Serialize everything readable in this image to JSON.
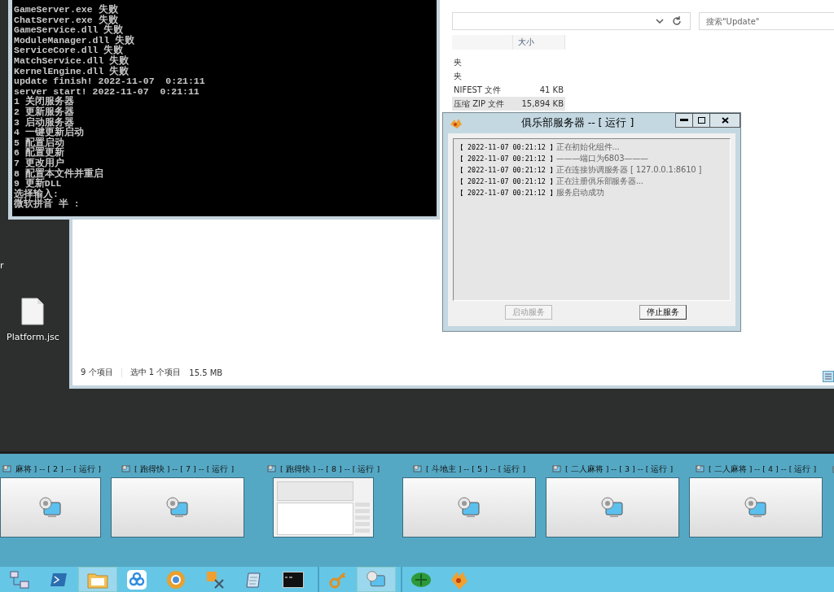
{
  "desktop": {
    "label_fragment": "r",
    "icons": [
      {
        "label": "Platform.jsc"
      }
    ]
  },
  "explorer": {
    "search": {
      "placeholder": "搜索\"Update\""
    },
    "columns": [
      "大小"
    ],
    "rows": [
      {
        "type": "夹",
        "size": "",
        "selected": false
      },
      {
        "type": "夹",
        "size": "",
        "selected": false
      },
      {
        "type": "NIFEST 文件",
        "size": "41 KB",
        "selected": false
      },
      {
        "type": "压缩 ZIP 文件",
        "size": "15,894 KB",
        "selected": true
      }
    ],
    "status": {
      "count": "9 个项目",
      "selection": "选中 1 个项目",
      "size": "15.5 MB"
    }
  },
  "console": {
    "lines": [
      "GameServer.exe 失败",
      "ChatServer.exe 失败",
      "GameService.dll 失败",
      "ModuleManager.dll 失败",
      "ServiceCore.dll 失败",
      "MatchService.dll 失败",
      "KernelEngine.dll 失败",
      "update finish! 2022-11-07  0:21:11",
      "server start! 2022-11-07  0:21:11",
      "1 关闭服务器",
      "2 更新服务器",
      "3 启动服务器",
      "4 一键更新启动",
      "5 配置启动",
      "6 配置更新",
      "7 更改用户",
      "8 配置本文件并重启",
      "9 更新DLL",
      "选择输入:",
      "微软拼音 半 :"
    ]
  },
  "club_window": {
    "title": "俱乐部服务器 -- [ 运行 ]",
    "log": [
      {
        "time": "【 2022-11-07 00:21:12 】",
        "message": "正在初始化组件..."
      },
      {
        "time": "【 2022-11-07 00:21:12 】",
        "message": "———端口为6803———"
      },
      {
        "time": "【 2022-11-07 00:21:12 】",
        "message": "正在连接协调服务器 [ 127.0.0.1:8610 ]"
      },
      {
        "time": "【 2022-11-07 00:21:12 】",
        "message": "正在注册俱乐部服务器..."
      },
      {
        "time": "【 2022-11-07 00:21:12 】",
        "message": "服务启动成功"
      }
    ],
    "buttons": [
      {
        "label": "启动服务",
        "disabled": true
      },
      {
        "label": "停止服务",
        "disabled": false
      }
    ]
  },
  "thumbnails": [
    {
      "title": "麻将 ] -- [ 2 ] -- [ 运行 ]",
      "kind": "icon"
    },
    {
      "title": "[ 跑得快 ] -- [ 7 ] -- [ 运行 ]",
      "kind": "icon"
    },
    {
      "title": "[ 跑得快 ] -- [ 8 ] -- [ 运行 ]",
      "kind": "preview"
    },
    {
      "title": "[ 斗地主 ] -- [ 5 ] -- [ 运行 ]",
      "kind": "icon"
    },
    {
      "title": "[ 二人麻将 ] -- [ 3 ] -- [ 运行 ]",
      "kind": "icon"
    },
    {
      "title": "[ 二人麻将 ] -- [ 4 ] -- [ 运行 ]",
      "kind": "icon"
    }
  ],
  "taskbar": [
    {
      "selected": false
    },
    {
      "selected": false
    },
    {
      "selected": true
    },
    {
      "selected": false
    },
    {
      "selected": false
    },
    {
      "selected": false
    },
    {
      "selected": false
    },
    {
      "selected": false
    },
    {
      "selected": false
    },
    {
      "selected": true
    },
    {
      "selected": false
    },
    {
      "selected": false
    }
  ]
}
